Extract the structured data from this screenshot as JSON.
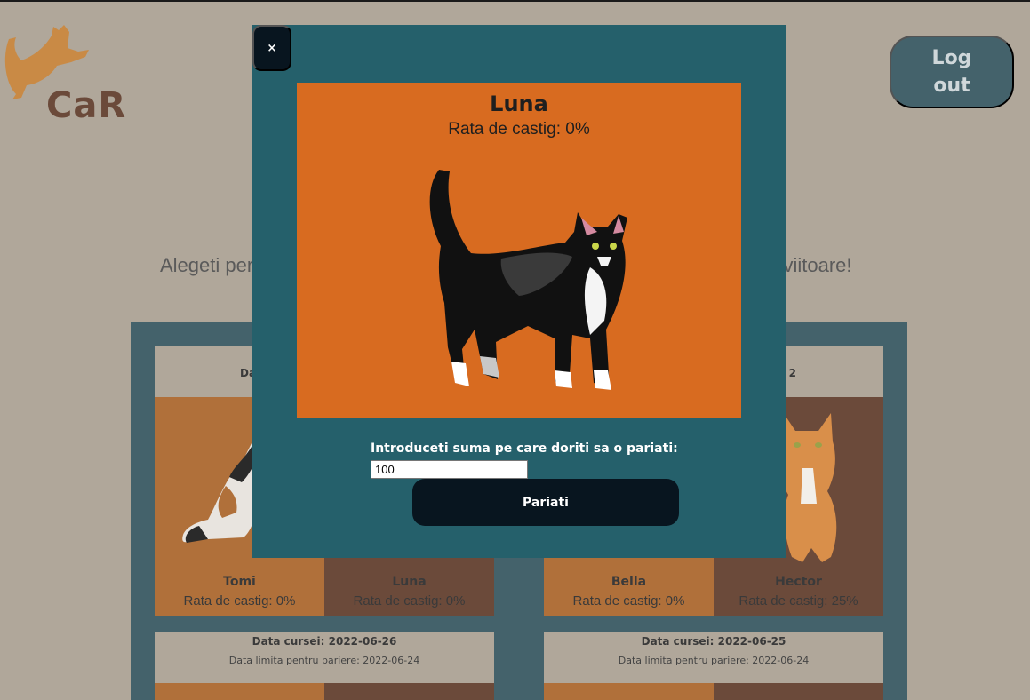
{
  "header": {
    "logo_text": "CaR",
    "logout_label": "Log\nout"
  },
  "subtitle": {
    "left_fragment": "Alegeti per",
    "right_fragment": "ele viitoare!"
  },
  "races": [
    {
      "date": "Dat",
      "limit": "",
      "cats": [
        {
          "name": "Tomi",
          "rate": "Rata de castig: 0%"
        },
        {
          "name": "Luna",
          "rate": "Rata de castig: 0%"
        }
      ]
    },
    {
      "date": "2",
      "limit": "",
      "cats": [
        {
          "name": "Bella",
          "rate": "Rata de castig: 0%"
        },
        {
          "name": "Hector",
          "rate": "Rata de castig: 25%"
        }
      ]
    },
    {
      "date": "Data cursei: 2022-06-26",
      "limit": "Data limita pentru pariere: 2022-06-24"
    },
    {
      "date": "Data cursei: 2022-06-25",
      "limit": "Data limita pentru pariere: 2022-06-24"
    }
  ],
  "modal": {
    "close_label": "×",
    "cat_name": "Luna",
    "cat_rate": "Rata de castig: 0%",
    "bet_label": "Introduceti suma pe care doriti sa o pariati:",
    "bet_value": "100",
    "bet_button": "Pariati"
  },
  "colors": {
    "background": "#b0a79a",
    "panel": "#44626b",
    "modal": "#25606b",
    "card_orange": "#d86b20",
    "button_dark": "#08151f"
  }
}
